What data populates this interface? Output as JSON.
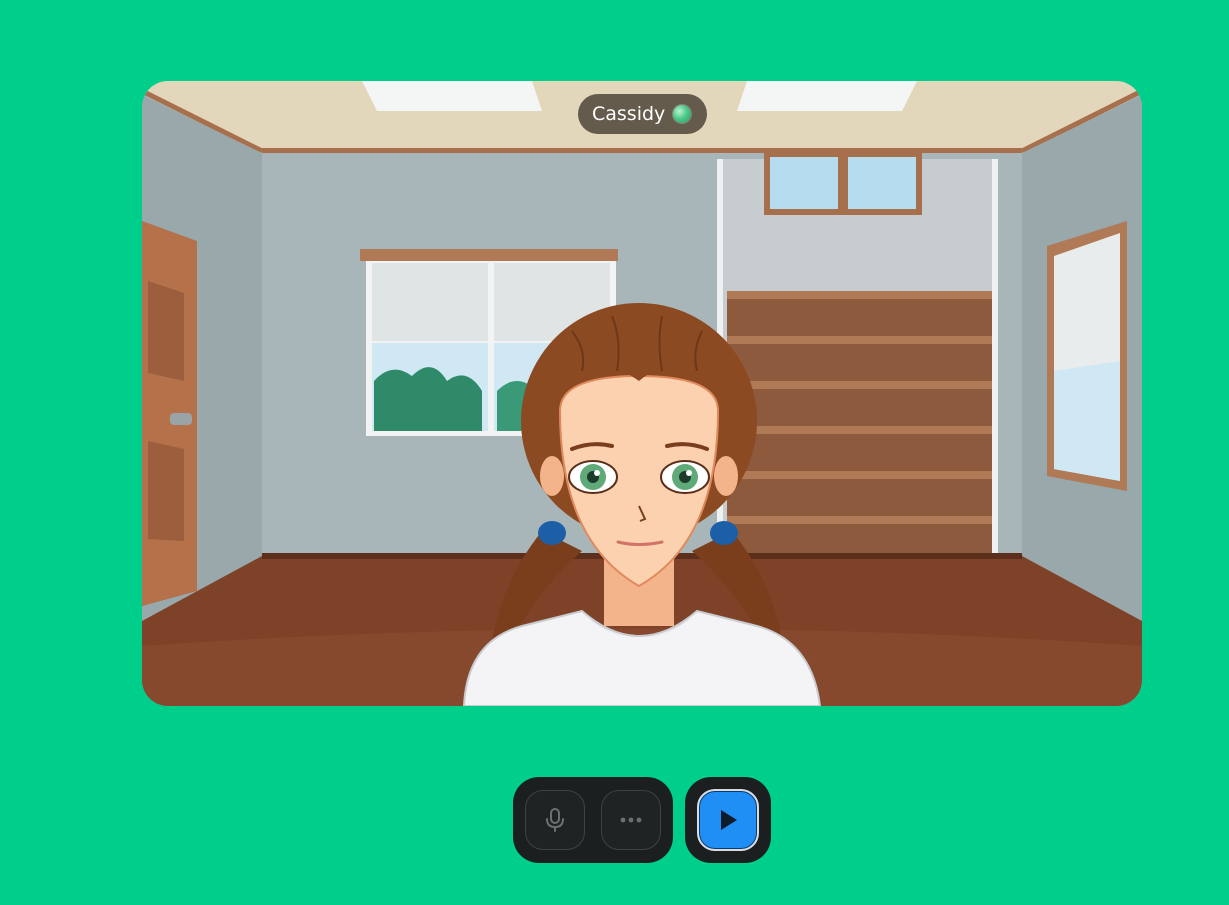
{
  "avatar": {
    "name": "Cassidy",
    "status_icon": "online-status-dot"
  },
  "controls": {
    "mic_icon": "microphone-icon",
    "more_icon": "more-options-icon",
    "play_icon": "play-icon"
  },
  "colors": {
    "page_background": "#00cf8c",
    "control_bar": "#1c1f1f",
    "play_button": "#1f8ef5"
  }
}
